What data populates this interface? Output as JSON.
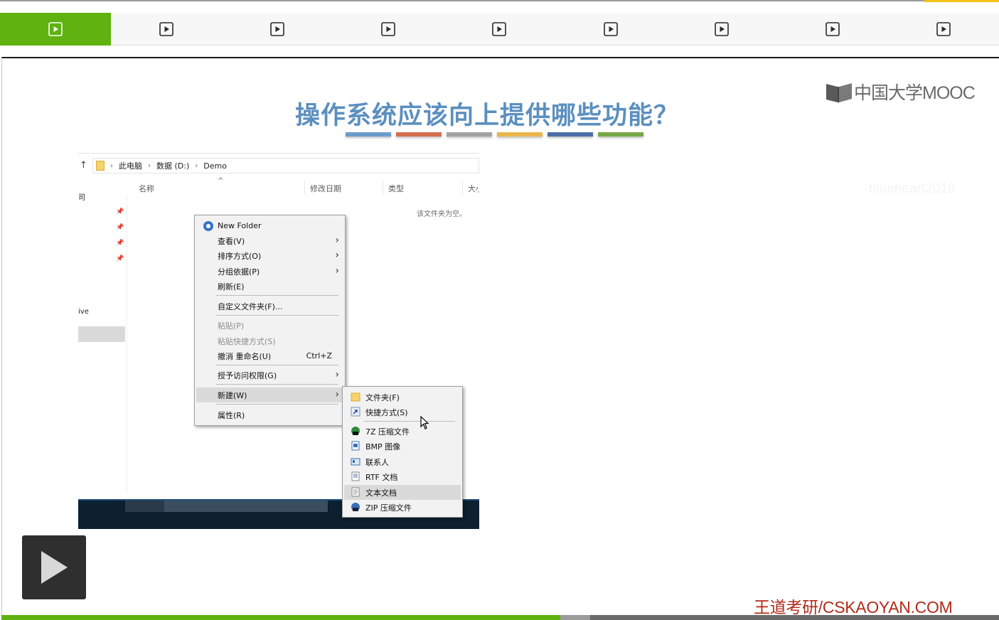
{
  "tabs": {
    "count": 9,
    "active_index": 0,
    "icon": "play-square-icon"
  },
  "logo": {
    "text": "中国大学MOOC",
    "icon": "mooc-book-icon"
  },
  "slide": {
    "title": "操作系统应该向上提供哪些功能？",
    "bar_colors": [
      "#6b9ccb",
      "#d2704f",
      "#a3a3a3",
      "#eab64c",
      "#4b6ea9",
      "#76a945"
    ]
  },
  "watermark_faint": "blueheart2019",
  "explorer": {
    "breadcrumb": [
      "此电脑",
      "数据 (D:)",
      "Demo"
    ],
    "columns": [
      "名称",
      "修改日期",
      "类型",
      "大小"
    ],
    "column_sort_glyph": "^",
    "empty_message": "该文件夹为空。",
    "nav_fragments": [
      "司",
      "ive"
    ],
    "context_menu": {
      "items": [
        {
          "label": "New Folder"
        },
        {
          "label": "查看(V)",
          "arrow": true
        },
        {
          "label": "排序方式(O)",
          "arrow": true
        },
        {
          "label": "分组依据(P)",
          "arrow": true
        },
        {
          "label": "刷新(E)"
        },
        {
          "label": "自定义文件夹(F)..."
        },
        {
          "label": "粘贴(P)",
          "disabled": true
        },
        {
          "label": "粘贴快捷方式(S)",
          "disabled": true
        },
        {
          "label": "撤消 重命名(U)",
          "shortcut": "Ctrl+Z"
        },
        {
          "label": "授予访问权限(G)",
          "arrow": true
        },
        {
          "label": "新建(W)",
          "arrow": true,
          "highlighted": true
        },
        {
          "label": "属性(R)"
        }
      ]
    },
    "submenu": {
      "items": [
        {
          "label": "文件夹(F)",
          "icon": "folder-icon"
        },
        {
          "label": "快捷方式(S)",
          "icon": "shortcut-icon"
        },
        {
          "label": "7Z 压缩文件",
          "icon": "7z-archive-icon"
        },
        {
          "label": "BMP 图像",
          "icon": "bmp-image-icon"
        },
        {
          "label": "联系人",
          "icon": "contact-card-icon"
        },
        {
          "label": "RTF 文档",
          "icon": "rtf-document-icon"
        },
        {
          "label": "文本文档",
          "icon": "text-document-icon",
          "highlighted": true
        },
        {
          "label": "ZIP 压缩文件",
          "icon": "zip-archive-icon"
        }
      ]
    }
  },
  "player": {
    "play_icon": "play-icon",
    "progress_fraction": 0.56,
    "buffered_fraction": 0.59,
    "colors": {
      "accent": "#5fb20f",
      "track": "#6a6a6a"
    }
  },
  "source_mark": "王道考研/CSKAOYAN.COM"
}
